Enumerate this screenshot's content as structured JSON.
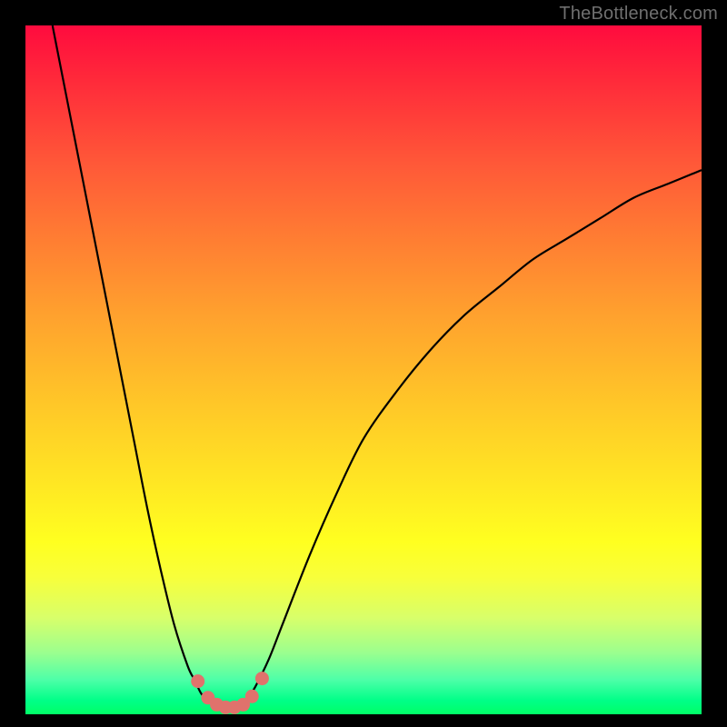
{
  "watermark": "TheBottleneck.com",
  "colors": {
    "frame_background_top": "#ff0b3e",
    "frame_background_bottom": "#00ff66",
    "page_background": "#000000",
    "curve": "#000000",
    "dots": "#e0726c",
    "watermark_text": "#6f6f6f"
  },
  "chart_data": {
    "type": "line",
    "title": "",
    "xlabel": "",
    "ylabel": "",
    "xlim": [
      0,
      100
    ],
    "ylim": [
      0,
      100
    ],
    "grid": false,
    "legend": false,
    "note": "Axes are unlabeled; values estimated from pixel positions. y measured from bottom (0) to top (100).",
    "series": [
      {
        "name": "left-branch",
        "x": [
          4,
          6,
          8,
          10,
          12,
          14,
          16,
          18,
          20,
          22,
          24,
          25,
          26,
          27,
          28
        ],
        "y": [
          100,
          90,
          80,
          70,
          60,
          50,
          40,
          30,
          21,
          13,
          7,
          5,
          3,
          2,
          1.3
        ]
      },
      {
        "name": "right-branch",
        "x": [
          32,
          33,
          34,
          36,
          38,
          42,
          46,
          50,
          55,
          60,
          65,
          70,
          75,
          80,
          85,
          90,
          95,
          100
        ],
        "y": [
          1.3,
          2.5,
          4,
          8,
          13,
          23,
          32,
          40,
          47,
          53,
          58,
          62,
          66,
          69,
          72,
          75,
          77,
          79
        ]
      },
      {
        "name": "valley-floor",
        "x": [
          28,
          29,
          30,
          31,
          32
        ],
        "y": [
          1.3,
          1.0,
          0.9,
          1.0,
          1.3
        ]
      }
    ],
    "markers": {
      "name": "valley-dots",
      "x": [
        25.5,
        27.0,
        28.3,
        29.6,
        30.9,
        32.2,
        33.5,
        35.0
      ],
      "y": [
        4.8,
        2.4,
        1.4,
        1.0,
        1.0,
        1.4,
        2.6,
        5.2
      ]
    }
  }
}
